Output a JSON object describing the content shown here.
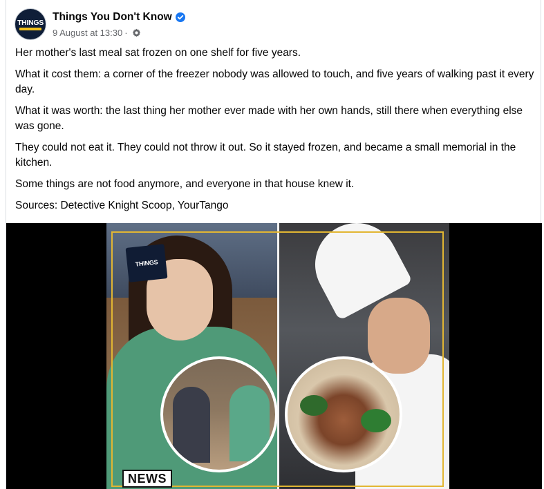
{
  "post": {
    "page_name": "Things You Don't Know",
    "avatar_logo_text": "THINGS",
    "timestamp": "9 August at 13:30",
    "separator": "·",
    "paragraphs": [
      "Her mother's last meal sat frozen on one shelf for five years.",
      "What it cost them: a corner of the freezer nobody was allowed to touch, and five years of walking past it every day.",
      "What it was worth: the last thing her mother ever made with her own hands, still there when everything else was gone.",
      "They could not eat it. They could not throw it out. So it stayed frozen, and became a small memorial in the kitchen.",
      "Some things are not food anymore, and everyone in that house knew it.",
      "Sources: Detective Knight Scoop, YourTango"
    ]
  },
  "media": {
    "watermark_text": "THINGS",
    "news_badge": "NEWS"
  },
  "colors": {
    "text_primary": "#050505",
    "text_secondary": "#65676b",
    "verified": "#1877f2",
    "frame_gold": "#e2b632"
  },
  "icons": {
    "verified": "verified-badge-icon",
    "privacy": "gear-icon"
  }
}
